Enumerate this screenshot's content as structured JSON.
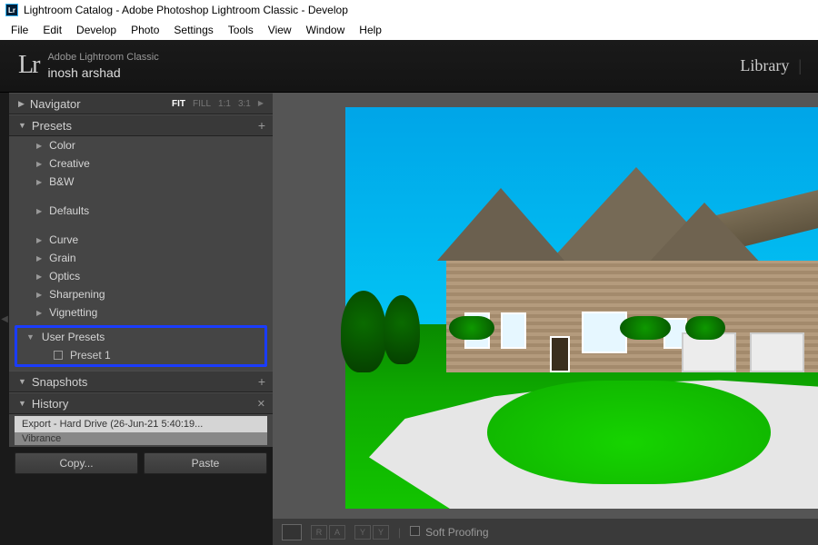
{
  "window_title": "Lightroom Catalog - Adobe Photoshop Lightroom Classic - Develop",
  "menu": [
    "File",
    "Edit",
    "Develop",
    "Photo",
    "Settings",
    "Tools",
    "View",
    "Window",
    "Help"
  ],
  "brand": {
    "logo": "Lr",
    "product": "Adobe Lightroom Classic",
    "user": "inosh arshad"
  },
  "module_picker": {
    "active": "Library"
  },
  "navigator": {
    "title": "Navigator",
    "zoom": [
      "FIT",
      "FILL",
      "1:1",
      "3:1"
    ],
    "active": "FIT"
  },
  "presets": {
    "title": "Presets",
    "groups1": [
      "Color",
      "Creative",
      "B&W"
    ],
    "groups2": [
      "Defaults"
    ],
    "groups3": [
      "Curve",
      "Grain",
      "Optics",
      "Sharpening",
      "Vignetting"
    ],
    "user": {
      "label": "User Presets",
      "items": [
        "Preset 1"
      ]
    }
  },
  "snapshots": {
    "title": "Snapshots"
  },
  "history": {
    "title": "History",
    "items": [
      "Export - Hard Drive (26-Jun-21 5:40:19...",
      "Vibrance"
    ]
  },
  "buttons": {
    "copy": "Copy...",
    "paste": "Paste"
  },
  "toolbar": {
    "softproof": "Soft Proofing",
    "ra": "R|A",
    "yy": "Y|Y"
  }
}
